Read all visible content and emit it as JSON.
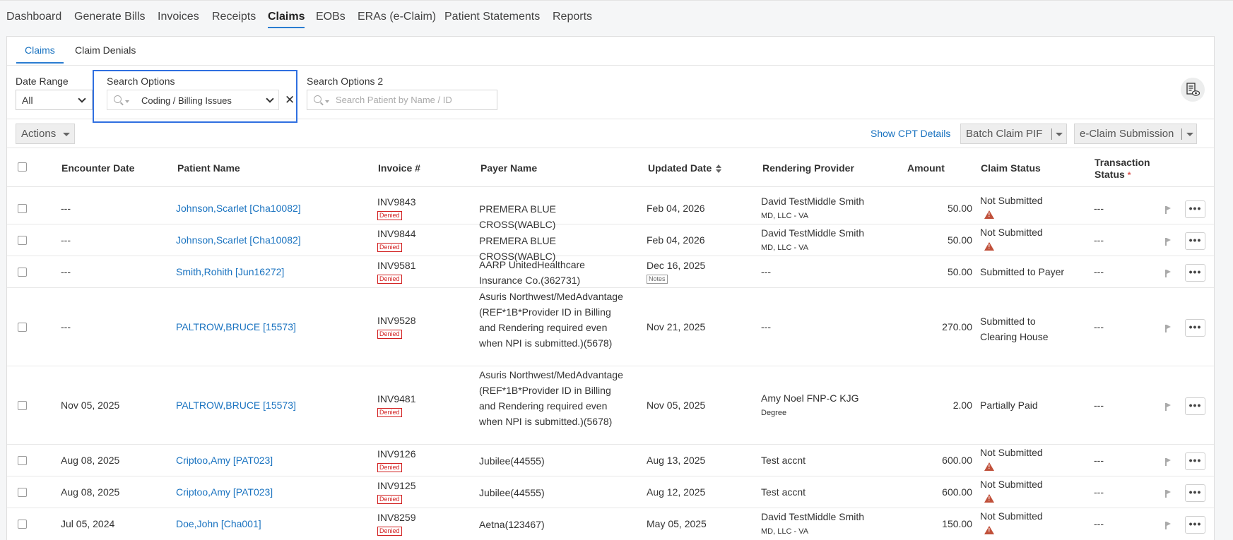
{
  "topnav": {
    "items": [
      "Dashboard",
      "Generate Bills",
      "Invoices",
      "Receipts",
      "Claims",
      "EOBs",
      "ERAs (e-Claim)",
      "Patient Statements",
      "Reports"
    ],
    "active": "Claims"
  },
  "subtabs": [
    "Claims",
    "Claim Denials"
  ],
  "filters": {
    "date_range_label": "Date Range",
    "date_range_value": "All",
    "search_options_label": "Search Options",
    "search_options_value": "Coding / Billing Issues",
    "search_options2_label": "Search Options 2",
    "search_placeholder": "Search Patient by Name / ID"
  },
  "toolbar": {
    "actions": "Actions",
    "show_cpt": "Show CPT Details",
    "batch_pif": "Batch Claim PIF",
    "eclaim": "e-Claim Submission"
  },
  "table": {
    "headers": {
      "encounter_date": "Encounter Date",
      "patient_name": "Patient Name",
      "invoice": "Invoice #",
      "payer_name": "Payer Name",
      "updated_date": "Updated Date",
      "rendering_provider": "Rendering Provider",
      "amount": "Amount",
      "claim_status": "Claim Status",
      "transaction_status_1": "Transaction",
      "transaction_status_2": "Status",
      "required_marker": "*"
    },
    "rows": [
      {
        "enc": "---",
        "patient": "Johnson,Scarlet [Cha10082]",
        "invoice": "INV9843",
        "badge": "Denied",
        "payer": "PREMERA BLUE CROSS(WABLC)",
        "updated": "Feb 04, 2026",
        "notes": "",
        "provider": "David TestMiddle Smith",
        "provider_sub": "MD, LLC - VA",
        "amount": "50.00",
        "status": "Not Submitted",
        "warn": true,
        "txn": "---"
      },
      {
        "enc": "---",
        "patient": "Johnson,Scarlet [Cha10082]",
        "invoice": "INV9844",
        "badge": "Denied",
        "payer": "PREMERA BLUE CROSS(WABLC)",
        "updated": "Feb 04, 2026",
        "notes": "",
        "provider": "David TestMiddle Smith",
        "provider_sub": "MD, LLC - VA",
        "amount": "50.00",
        "status": "Not Submitted",
        "warn": true,
        "txn": "---"
      },
      {
        "enc": "---",
        "patient": "Smith,Rohith [Jun16272]",
        "invoice": "INV9581",
        "badge": "Denied",
        "payer": "AARP UnitedHealthcare Insurance Co.(362731)",
        "updated": "Dec 16, 2025",
        "notes": "Notes",
        "provider": "---",
        "provider_sub": "",
        "amount": "50.00",
        "status": "Submitted to Payer",
        "warn": false,
        "txn": "---"
      },
      {
        "enc": "---",
        "patient": "PALTROW,BRUCE [15573]",
        "invoice": "INV9528",
        "badge": "Denied",
        "payer": "Asuris Northwest/MedAdvantage (REF*1B*Provider ID in Billing and Rendering required even when NPI is submitted.)(5678)",
        "updated": "Nov 21, 2025",
        "notes": "",
        "provider": "---",
        "provider_sub": "",
        "amount": "270.00",
        "status": "Submitted to Clearing House",
        "warn": false,
        "txn": "---"
      },
      {
        "enc": "Nov 05, 2025",
        "patient": "PALTROW,BRUCE [15573]",
        "invoice": "INV9481",
        "badge": "Denied",
        "payer": "Asuris Northwest/MedAdvantage (REF*1B*Provider ID in Billing and Rendering required even when NPI is submitted.)(5678)",
        "updated": "Nov 05, 2025",
        "notes": "",
        "provider": "Amy Noel FNP-C KJG",
        "provider_sub": "Degree",
        "amount": "2.00",
        "status": "Partially Paid",
        "warn": false,
        "txn": "---"
      },
      {
        "enc": "Aug 08, 2025",
        "patient": "Criptoo,Amy [PAT023]",
        "invoice": "INV9126",
        "badge": "Denied",
        "payer": "Jubilee(44555)",
        "updated": "Aug 13, 2025",
        "notes": "",
        "provider": "Test accnt",
        "provider_sub": "",
        "amount": "600.00",
        "status": "Not Submitted",
        "warn": true,
        "txn": "---"
      },
      {
        "enc": "Aug 08, 2025",
        "patient": "Criptoo,Amy [PAT023]",
        "invoice": "INV9125",
        "badge": "Denied",
        "payer": "Jubilee(44555)",
        "updated": "Aug 12, 2025",
        "notes": "",
        "provider": "Test accnt",
        "provider_sub": "",
        "amount": "600.00",
        "status": "Not Submitted",
        "warn": true,
        "txn": "---"
      },
      {
        "enc": "Jul 05, 2024",
        "patient": "Doe,John [Cha001]",
        "invoice": "INV8259",
        "badge": "Denied",
        "payer": "Aetna(123467)",
        "updated": "May 05, 2025",
        "notes": "",
        "provider": "David TestMiddle Smith",
        "provider_sub": "MD, LLC - VA",
        "amount": "150.00",
        "status": "Not Submitted",
        "warn": true,
        "txn": "---"
      }
    ]
  },
  "colors": {
    "link": "#1a73c0",
    "accent": "#2a7dd1",
    "highlight": "#2f6fe0",
    "denied": "#d21f1f",
    "warning": "#c0503a"
  }
}
